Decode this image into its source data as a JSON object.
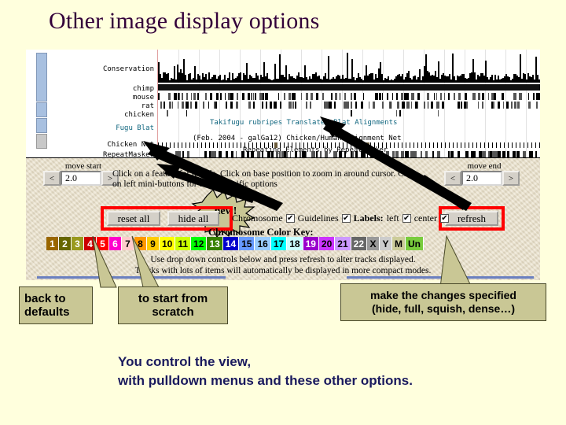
{
  "slide": {
    "title": "Other image display options",
    "caption_line1": "You control the view,",
    "caption_line2": "with pulldown menus and these other options."
  },
  "browser": {
    "track_labels": [
      {
        "text": "Conservation",
        "color": "#000000"
      },
      {
        "text": "chimp",
        "color": "#000000"
      },
      {
        "text": "mouse",
        "color": "#000000"
      },
      {
        "text": "rat",
        "color": "#000000"
      },
      {
        "text": "chicken",
        "color": "#000000"
      },
      {
        "text": "Fugu Blat",
        "color": "#10667f"
      },
      {
        "text": "Chicken Net",
        "color": "#000000"
      },
      {
        "text": "RepeatMasker",
        "color": "#000000"
      }
    ],
    "track_headers": [
      "Takifugu rubripes Translated Blat Alignments",
      "(Feb. 2004 - galGa12) Chicken/Human Alignment Net",
      "Repeating Elements by RepeatMasker"
    ],
    "move_start": {
      "label": "move start",
      "value": "2.0",
      "prev": "<",
      "next": ">"
    },
    "move_end": {
      "label": "move end",
      "value": "2.0",
      "prev": "<",
      "next": ">"
    },
    "instructions_line1": "Click on a feature for details. Click on base position to zoom in around cursor. Click",
    "instructions_line2": "on left mini-buttons for track-specific options",
    "new_badge": "new!",
    "buttons": {
      "reset_all": "reset all",
      "hide_all": "hide all",
      "refresh": "refresh"
    },
    "checkboxes": [
      {
        "label": "Chromosome",
        "checked": true,
        "bold": false
      },
      {
        "label": "Guidelines",
        "checked": true,
        "bold": false
      },
      {
        "label": "Labels:",
        "checked": false,
        "bold": true
      },
      {
        "label": "left",
        "checked": true,
        "bold": false
      },
      {
        "label": "center",
        "checked": true,
        "bold": false
      }
    ],
    "color_key_title": "Chromosome Color Key:",
    "chromosomes": [
      {
        "name": "1",
        "bg": "#996600",
        "fg": "#ffffff"
      },
      {
        "name": "2",
        "bg": "#666600",
        "fg": "#ffffff"
      },
      {
        "name": "3",
        "bg": "#99991e",
        "fg": "#ffffff"
      },
      {
        "name": "4",
        "bg": "#cc0000",
        "fg": "#ffffff"
      },
      {
        "name": "5",
        "bg": "#ff0000",
        "fg": "#ffffff"
      },
      {
        "name": "6",
        "bg": "#ff00cc",
        "fg": "#ffffff"
      },
      {
        "name": "7",
        "bg": "#ffcccc",
        "fg": "#000000"
      },
      {
        "name": "8",
        "bg": "#ff9900",
        "fg": "#000000"
      },
      {
        "name": "9",
        "bg": "#ffcc00",
        "fg": "#000000"
      },
      {
        "name": "10",
        "bg": "#ffff00",
        "fg": "#000000"
      },
      {
        "name": "11",
        "bg": "#ccff00",
        "fg": "#000000"
      },
      {
        "name": "12",
        "bg": "#00ff00",
        "fg": "#000000"
      },
      {
        "name": "13",
        "bg": "#358000",
        "fg": "#ffffff"
      },
      {
        "name": "14",
        "bg": "#0000cc",
        "fg": "#ffffff"
      },
      {
        "name": "15",
        "bg": "#6699ff",
        "fg": "#000000"
      },
      {
        "name": "16",
        "bg": "#99ccff",
        "fg": "#000000"
      },
      {
        "name": "17",
        "bg": "#00ffff",
        "fg": "#000000"
      },
      {
        "name": "18",
        "bg": "#ccffff",
        "fg": "#000000"
      },
      {
        "name": "19",
        "bg": "#9900cc",
        "fg": "#ffffff"
      },
      {
        "name": "20",
        "bg": "#cc33ff",
        "fg": "#000000"
      },
      {
        "name": "21",
        "bg": "#cc99ff",
        "fg": "#000000"
      },
      {
        "name": "22",
        "bg": "#666666",
        "fg": "#ffffff"
      },
      {
        "name": "X",
        "bg": "#999999",
        "fg": "#000000"
      },
      {
        "name": "Y",
        "bg": "#cccccc",
        "fg": "#000000"
      },
      {
        "name": "M",
        "bg": "#cccc99",
        "fg": "#000000"
      },
      {
        "name": "Un",
        "bg": "#79cc3d",
        "fg": "#000000"
      }
    ],
    "footer_line1": "Use drop down controls below and press refresh to alter tracks displayed.",
    "footer_line2": "Tracks with lots of items will automatically be displayed in more compact modes."
  },
  "callouts": {
    "back_to_defaults": "back to\ndefaults",
    "start_from_scratch": "to start from\nscratch",
    "make_changes": "make the changes specified\n(hide, full, squish, dense…)"
  }
}
